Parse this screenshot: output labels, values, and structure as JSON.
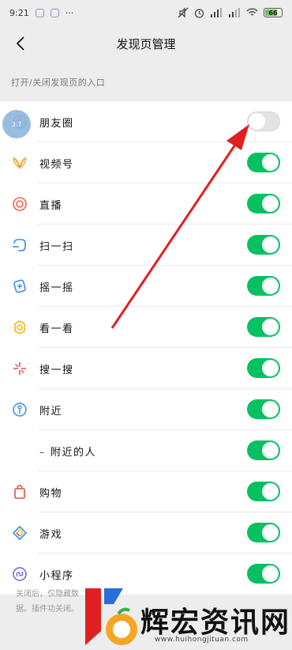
{
  "status_bar": {
    "time": "9:21",
    "battery": "66"
  },
  "nav": {
    "title": "发现页管理"
  },
  "section": {
    "caption": "打开/关闭发现页的入口"
  },
  "items": [
    {
      "label": "朋友圈",
      "icon": "moments-icon",
      "enabled": false
    },
    {
      "label": "视频号",
      "icon": "channels-icon",
      "enabled": true
    },
    {
      "label": "直播",
      "icon": "live-icon",
      "enabled": true
    },
    {
      "label": "扫一扫",
      "icon": "scan-icon",
      "enabled": true
    },
    {
      "label": "摇一摇",
      "icon": "shake-icon",
      "enabled": true
    },
    {
      "label": "看一看",
      "icon": "top-stories-icon",
      "enabled": true
    },
    {
      "label": "搜一搜",
      "icon": "search-icon",
      "enabled": true
    },
    {
      "label": "附近",
      "icon": "nearby-icon",
      "enabled": true
    },
    {
      "label": "附近的人",
      "icon": "",
      "enabled": true,
      "sub": true
    },
    {
      "label": "购物",
      "icon": "shopping-icon",
      "enabled": true
    },
    {
      "label": "游戏",
      "icon": "games-icon",
      "enabled": true
    },
    {
      "label": "小程序",
      "icon": "mini-programs-icon",
      "enabled": true
    }
  ],
  "footer": {
    "note": "关闭后，仅隐藏数据。插件功关闭。"
  },
  "floating_badge": {
    "text": "3.7"
  },
  "watermark": {
    "text": "辉宏资讯网",
    "url": "www.huihongjituan.com"
  },
  "colors": {
    "toggle_on": "#07c160",
    "toggle_off": "#e3e3e3",
    "annotation_arrow": "#e02020"
  }
}
